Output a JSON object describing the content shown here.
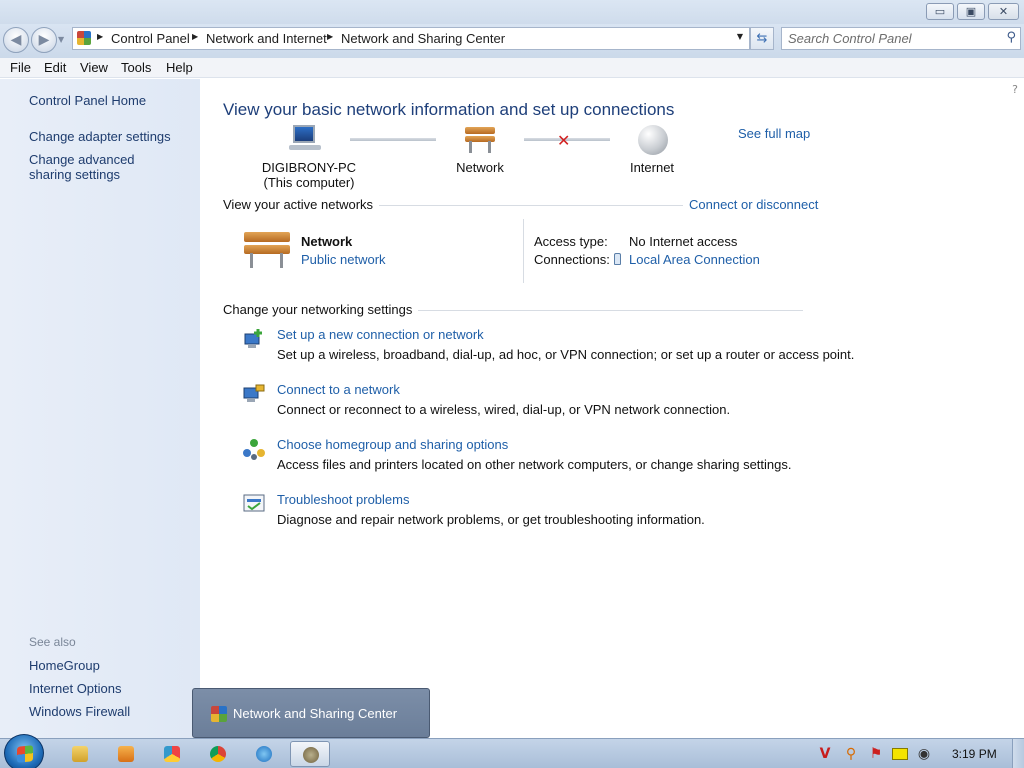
{
  "window": {
    "title_buttons": {
      "minimize": "▭",
      "maximize": "▣",
      "close": "✕"
    }
  },
  "nav": {
    "back_glyph": "◀",
    "forward_glyph": "▶",
    "breadcrumbs": [
      "Control Panel",
      "Network and Internet",
      "Network and Sharing Center"
    ],
    "refresh_glyph": "⇆",
    "search_placeholder": "Search Control Panel",
    "icons": {
      "control_panel": "control-panel-icon",
      "search": "search-icon",
      "refresh": "refresh-icon"
    }
  },
  "menu": {
    "items": [
      "File",
      "Edit",
      "View",
      "Tools",
      "Help"
    ]
  },
  "left_pane": {
    "home": "Control Panel Home",
    "links": [
      "Change adapter settings",
      "Change advanced sharing settings"
    ],
    "see_also_label": "See also",
    "see_also": [
      "HomeGroup",
      "Internet Options",
      "Windows Firewall"
    ]
  },
  "main": {
    "title": "View your basic network information and set up connections",
    "see_full_map": "See full map",
    "map": {
      "computer_name": "DIGIBRONY-PC",
      "computer_sub": "(This computer)",
      "network": "Network",
      "internet": "Internet",
      "status": "disconnected"
    },
    "active_networks": {
      "label": "View your active networks",
      "connect_link": "Connect or disconnect",
      "network_name": "Network",
      "network_type": "Public network",
      "access_type_label": "Access type:",
      "access_type_value": "No Internet access",
      "connections_label": "Connections:",
      "connections_value": "Local Area Connection"
    },
    "settings": {
      "label": "Change your networking settings",
      "tasks": [
        {
          "title": "Set up a new connection or network",
          "desc": "Set up a wireless, broadband, dial-up, ad hoc, or VPN connection; or set up a router or access point.",
          "icon": "new-connection-icon"
        },
        {
          "title": "Connect to a network",
          "desc": "Connect or reconnect to a wireless, wired, dial-up, or VPN network connection.",
          "icon": "connect-network-icon"
        },
        {
          "title": "Choose homegroup and sharing options",
          "desc": "Access files and printers located on other network computers, or change sharing settings.",
          "icon": "homegroup-icon"
        },
        {
          "title": "Troubleshoot problems",
          "desc": "Diagnose and repair network problems, or get troubleshooting information.",
          "icon": "troubleshoot-icon"
        }
      ]
    }
  },
  "taskbar": {
    "thumbnail_label": "Network and Sharing Center",
    "clock": "3:19 PM",
    "tray_glyphs": [
      "V",
      "⚲",
      "⚑",
      "▭",
      "◉"
    ],
    "apps": [
      "explorer-icon",
      "media-player-icon",
      "paint-icon",
      "chrome-icon",
      "internet-explorer-icon",
      "control-panel-icon"
    ],
    "colors": {
      "accent": "#1f5fa8",
      "title": "#1e3f7a"
    }
  }
}
